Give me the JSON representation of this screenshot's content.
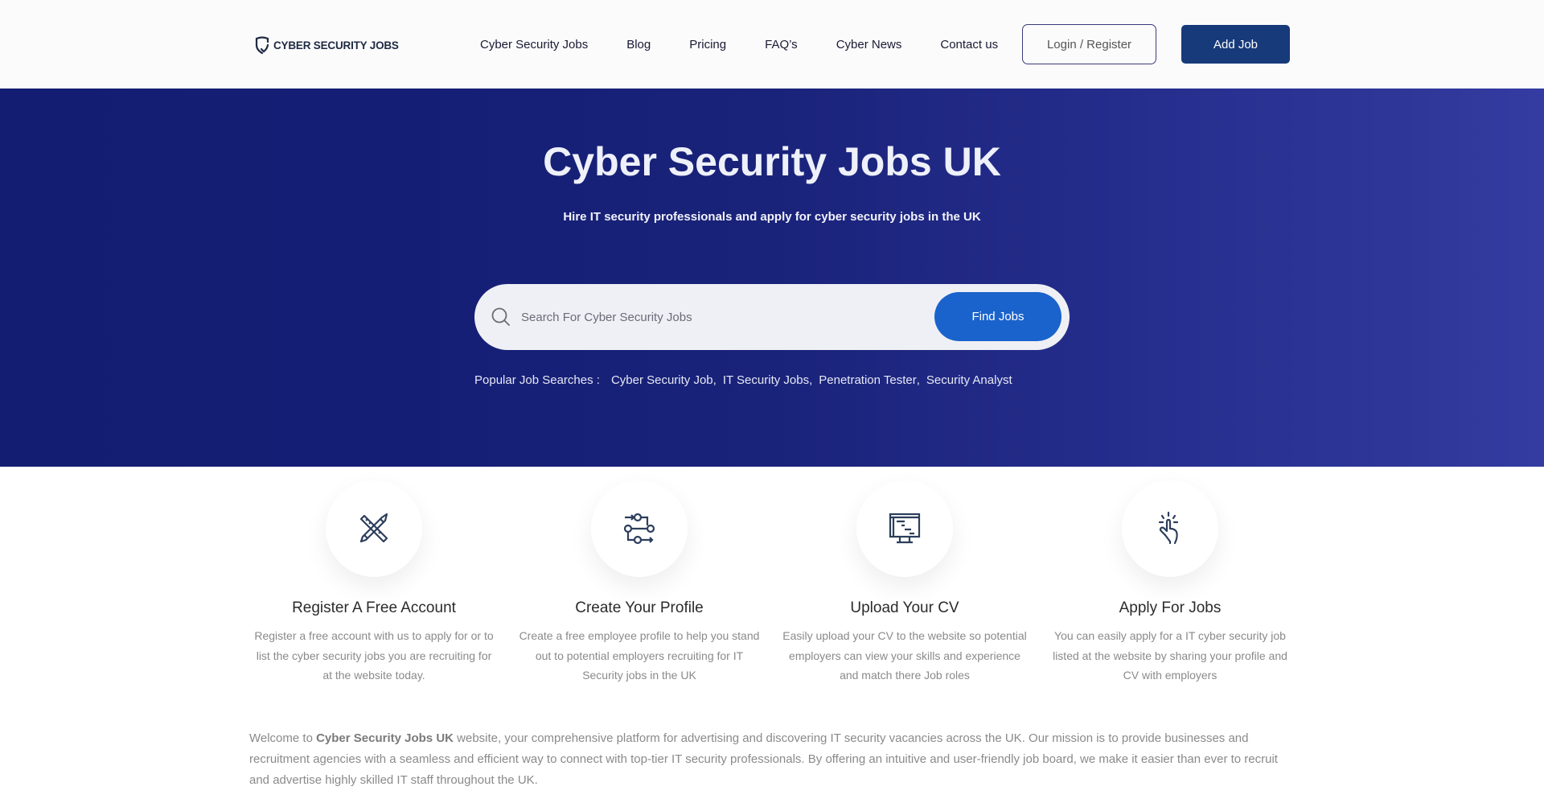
{
  "header": {
    "logo_text": "CYBER SECURITY JOBS",
    "nav": [
      {
        "label": "Cyber Security Jobs"
      },
      {
        "label": "Blog"
      },
      {
        "label": "Pricing"
      },
      {
        "label": "FAQ’s"
      },
      {
        "label": "Cyber News"
      },
      {
        "label": "Contact us"
      }
    ],
    "login_label": "Login / Register",
    "add_job_label": "Add Job"
  },
  "hero": {
    "title": "Cyber Security Jobs UK",
    "subtitle": "Hire IT security professionals and apply for cyber security jobs in the UK",
    "search": {
      "icon": "search-icon",
      "placeholder": "Search For Cyber Security Jobs",
      "value": "",
      "button_label": "Find Jobs"
    },
    "popular": {
      "label": "Popular Job Searches :",
      "items": [
        {
          "label": "Cyber Security Job",
          "sep": ","
        },
        {
          "label": "IT Security Jobs",
          "sep": ","
        },
        {
          "label": "Penetration Tester",
          "sep": ","
        },
        {
          "label": "Security Analyst",
          "sep": ""
        }
      ]
    }
  },
  "steps": [
    {
      "icon": "pencil-ruler-icon",
      "title": "Register A Free Account",
      "desc": "Register a free account with us to apply for or to list the cyber security jobs you are recruiting for at the website today."
    },
    {
      "icon": "workflow-icon",
      "title": "Create Your Profile",
      "desc": "Create a free employee profile to help you stand out to potential employers recruiting for IT Security jobs in the UK"
    },
    {
      "icon": "monitor-icon",
      "title": "Upload Your CV",
      "desc": "Easily upload your CV to the website so potential employers can view your skills and experience and match there Job roles"
    },
    {
      "icon": "tap-hand-icon",
      "title": "Apply For Jobs",
      "desc": "You can easily apply for a IT cyber security job listed at the website by sharing your profile and CV with employers"
    }
  ],
  "intro": {
    "prefix": "Welcome to ",
    "brand": "Cyber Security Jobs UK",
    "text": " website, your comprehensive platform for advertising and discovering IT security vacancies across the UK. Our mission is to provide businesses and recruitment agencies with a seamless and efficient way to connect with top-tier IT security professionals. By offering an intuitive and user-friendly job board, we make it easier than ever to recruit and advertise highly skilled IT staff throughout the UK."
  },
  "colors": {
    "hero_start": "#131d72",
    "hero_end": "#343ca2",
    "primary_button": "#1a63cc",
    "add_job_button": "#173a7a",
    "icon_color": "#2c3e5c"
  }
}
